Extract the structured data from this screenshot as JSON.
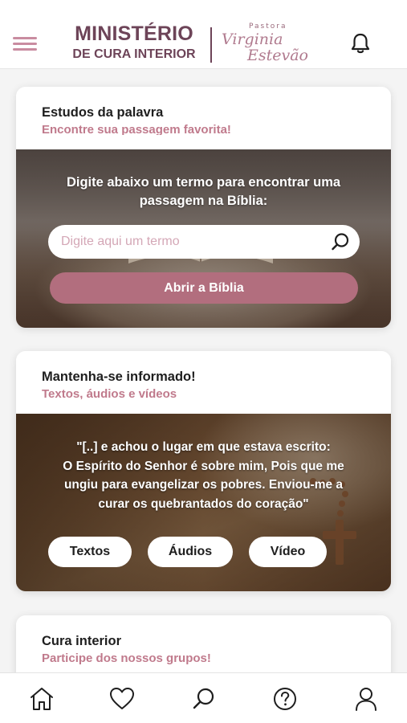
{
  "header": {
    "brand_line1": "MINISTÉRIO",
    "brand_line2": "DE CURA INTERIOR",
    "script_small": "Pastora",
    "script_line1": "Virginia",
    "script_line2": "Estevão",
    "menu_icon": "hamburger-menu-icon",
    "notification_icon": "bell-icon"
  },
  "bible_card": {
    "title": "Estudos da palavra",
    "subtitle": "Encontre sua passagem favorita!",
    "prompt_line1": "Digite abaixo um termo para encontrar uma",
    "prompt_line2": "passagem na Bíblia:",
    "search_placeholder": "Digite aqui um termo",
    "search_icon": "search-icon",
    "open_button": "Abrir a Bíblia"
  },
  "news_card": {
    "title": "Mantenha-se informado!",
    "subtitle": "Textos, áudios e vídeos",
    "quote_line1": "\"[..] e achou o lugar em que estava escrito:",
    "quote_line2": "O Espírito do Senhor é sobre mim, Pois que me",
    "quote_line3": "ungiu para evangelizar os pobres. Enviou-me a",
    "quote_line4": "curar os quebrantados do coração\"",
    "buttons": [
      "Textos",
      "Áudios",
      "Vídeo"
    ]
  },
  "cura_card": {
    "title": "Cura interior",
    "subtitle": "Participe dos nossos grupos!"
  },
  "bottom_nav": [
    "home-icon",
    "heart-icon",
    "search-icon",
    "help-icon",
    "user-icon"
  ],
  "colors": {
    "brand": "#6d4458",
    "accent": "#c07a8c",
    "button": "#b26e7e",
    "placeholder": "#d4a7b6"
  }
}
